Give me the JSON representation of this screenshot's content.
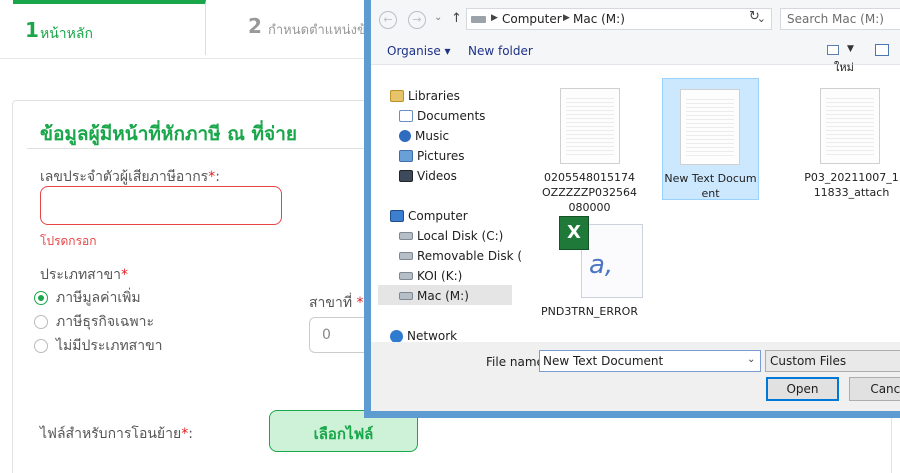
{
  "form": {
    "steps": [
      {
        "number": "1",
        "label": "หน้าหลัก"
      },
      {
        "number": "2",
        "label": "กำหนดตำแหน่งข้"
      }
    ],
    "section_title": "ข้อมูลผู้มีหน้าที่หักภาษี ณ ที่จ่าย",
    "taxid_label": "เลขประจำตัวผู้เสียภาษีอากร",
    "required_mark": "*",
    "taxid_colon": ":",
    "taxid_error": "โปรดกรอก",
    "branch_type_label": "ประเภทสาขา",
    "branch_options": [
      {
        "label": "ภาษีมูลค่าเพิ่ม",
        "selected": true
      },
      {
        "label": "ภาษีธุรกิจเฉพาะ",
        "selected": false
      },
      {
        "label": "ไม่มีประเภทสาขา",
        "selected": false
      }
    ],
    "branch_no_label": "สาขาที่",
    "branch_no_value": "0",
    "transfer_file_label": "ไฟล์สำหรับการโอนย้าย",
    "transfer_file_colon": ":",
    "choose_file_button": "เลือกไฟล์"
  },
  "dialog": {
    "address": {
      "crumbs": [
        "Computer",
        "Mac (M:)"
      ]
    },
    "search_placeholder": "Search Mac (M:)",
    "toolbar": {
      "organise": "Organise ▾",
      "new_folder": "New folder"
    },
    "nav_back": "←",
    "nav_forward": "→",
    "nav_recent": "⌄",
    "nav_up": "↑",
    "refresh": "↻",
    "overflow_label": "ใหม่",
    "sidebar": [
      {
        "label": "Libraries",
        "icon": "library-icon"
      },
      {
        "label": "Documents",
        "icon": "documents-icon"
      },
      {
        "label": "Music",
        "icon": "music-icon"
      },
      {
        "label": "Pictures",
        "icon": "pictures-icon"
      },
      {
        "label": "Videos",
        "icon": "videos-icon"
      },
      {
        "label": "Computer",
        "icon": "computer-icon"
      },
      {
        "label": "Local Disk (C:)",
        "icon": "local-disk-icon"
      },
      {
        "label": "Removable Disk (",
        "icon": "removable-disk-icon"
      },
      {
        "label": "KOI (K:)",
        "icon": "drive-icon"
      },
      {
        "label": "Mac (M:)",
        "icon": "drive-icon",
        "selected": true
      },
      {
        "label": "Network",
        "icon": "network-icon"
      }
    ],
    "files": [
      {
        "name": "0205548015174OZZZZZP032564080000",
        "type": "text-document",
        "selected": false
      },
      {
        "name": "New Text Document",
        "type": "text-document",
        "selected": true
      },
      {
        "name": "P03_20211007_111833_attach",
        "type": "text-document",
        "selected": false
      },
      {
        "name": "PND3TRN_ERROR",
        "type": "excel-file",
        "selected": false
      }
    ],
    "filename_label": "File name:",
    "filename_value": "New Text Document",
    "filetype_value": "Custom Files",
    "open_button": "Open",
    "cancel_button": "Cance"
  },
  "colors": {
    "accent": "#1aa64a",
    "error": "#e54545",
    "dialog_border": "#5d9bd1",
    "selection": "#cce8ff"
  }
}
